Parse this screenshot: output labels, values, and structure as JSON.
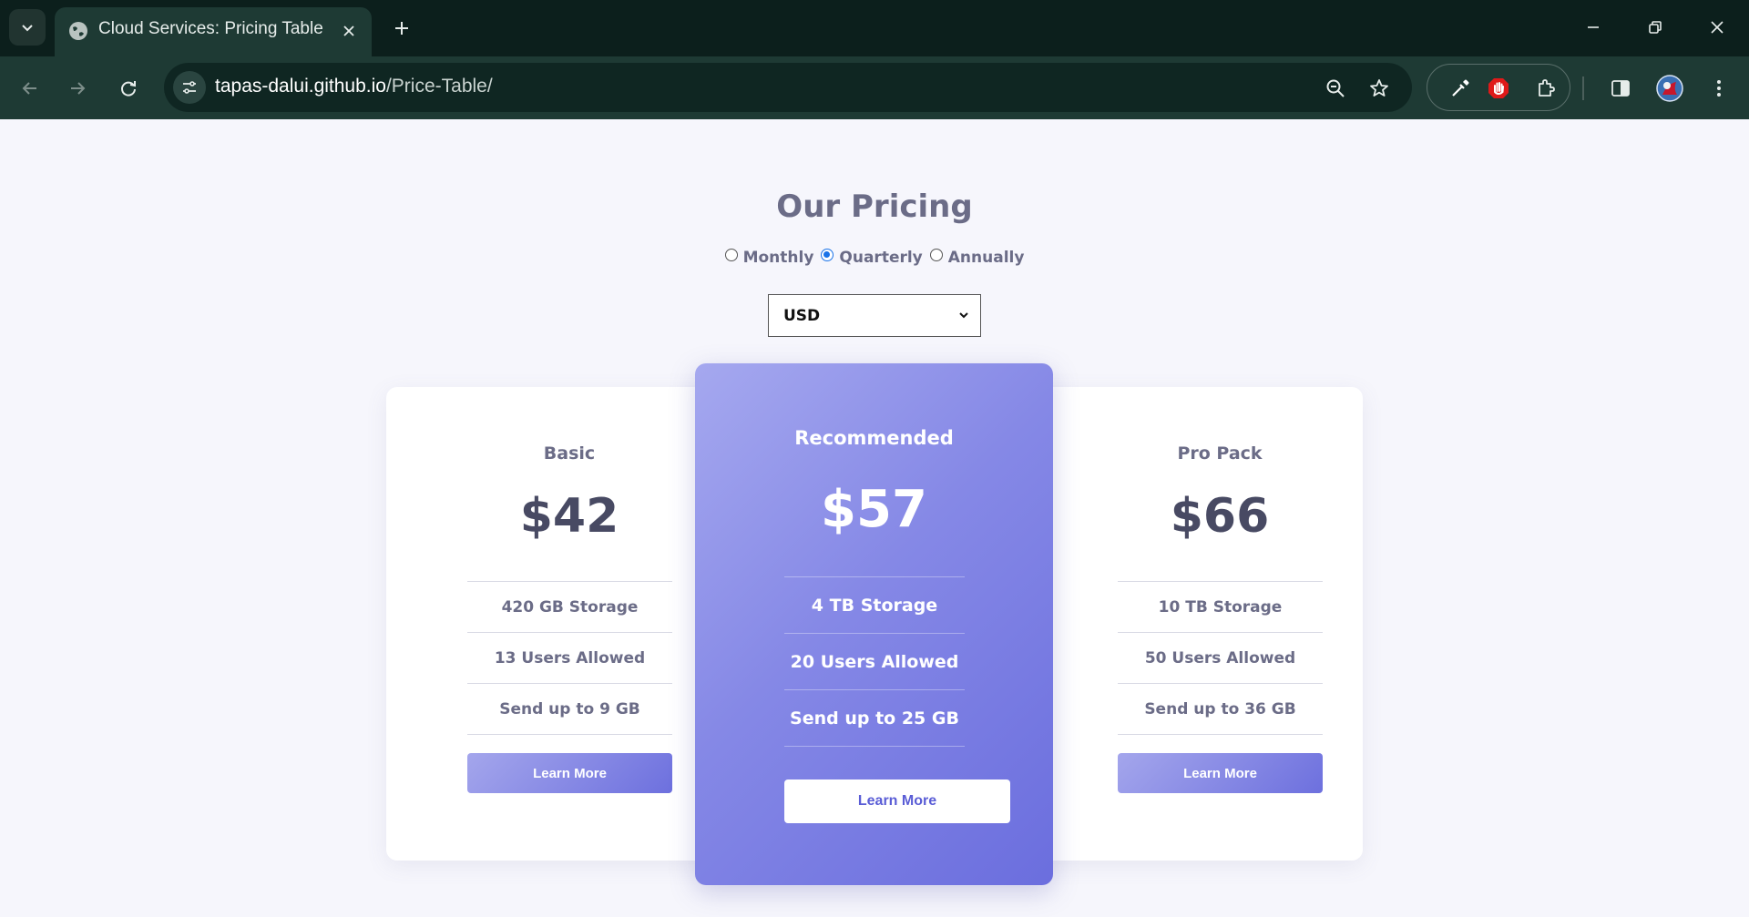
{
  "browser": {
    "tab_title": "Cloud Services: Pricing Table",
    "url_host": "tapas-dalui.github.io",
    "url_path": "/Price-Table/"
  },
  "page": {
    "heading": "Our Pricing",
    "billing_options": [
      {
        "label": "Monthly",
        "checked": false
      },
      {
        "label": "Quarterly",
        "checked": true
      },
      {
        "label": "Annually",
        "checked": false
      }
    ],
    "currency": {
      "selected": "USD"
    },
    "plans": [
      {
        "name": "Basic",
        "price": "$42",
        "features": [
          "420 GB Storage",
          "13 Users Allowed",
          "Send up to 9 GB"
        ],
        "button": "Learn More"
      },
      {
        "name": "Recommended",
        "price": "$57",
        "features": [
          "4 TB Storage",
          "20 Users Allowed",
          "Send up to 25 GB"
        ],
        "button": "Learn More"
      },
      {
        "name": "Pro Pack",
        "price": "$66",
        "features": [
          "10 TB Storage",
          "50 Users Allowed",
          "Send up to 36 GB"
        ],
        "button": "Learn More"
      }
    ]
  },
  "colors": {
    "chrome_bg": "#0c1f1c",
    "toolbar_bg": "#1e3a34",
    "page_bg": "#f6f6fc",
    "text_muted": "#6b6c87",
    "price_dark": "#484a63",
    "accent_start": "#a5a8ef",
    "accent_end": "#6b6ede"
  }
}
